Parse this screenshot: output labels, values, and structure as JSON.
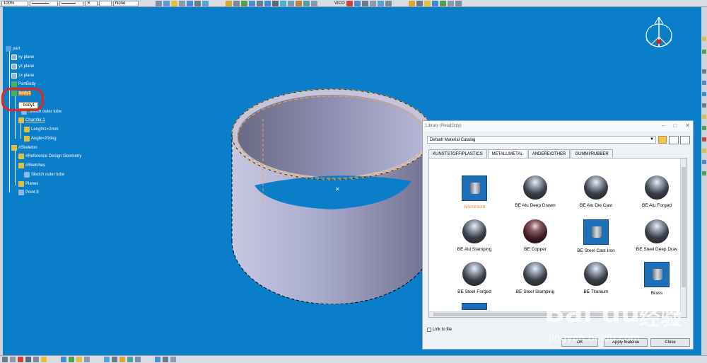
{
  "toolbar": {
    "zoom": "100%",
    "line_type": "",
    "line_weight": "",
    "pattern": "",
    "layer": "None",
    "vico": "VICO"
  },
  "tree": {
    "root": "part",
    "items": [
      {
        "label": "xy plane"
      },
      {
        "label": "yz plane"
      },
      {
        "label": "zx plane"
      },
      {
        "label": "PartBody"
      },
      {
        "label": "body1"
      },
      {
        "label": "Sketch outer tube"
      },
      {
        "label": "Chamfer.1"
      },
      {
        "label": "Length1=2mm"
      },
      {
        "label": "Angle=20deg"
      },
      {
        "label": "#Skeleton"
      },
      {
        "label": "#Reference Design Geometry"
      },
      {
        "label": "#Sketches"
      },
      {
        "label": "Sketch outer tube"
      },
      {
        "label": "Planes"
      },
      {
        "label": "Point.9"
      }
    ],
    "tooltip": "body1"
  },
  "dialog": {
    "title": "Library (ReadOnly)",
    "catalog": "Default Material Catalog",
    "tabs": [
      "KUNSTSTOFF/PLASTICS",
      "METALL/METAL",
      "ANDERE/OTHER",
      "GUMMI/RUBBER"
    ],
    "materials": [
      {
        "label": "Aluminium",
        "kind": "swatch"
      },
      {
        "label": "BE Alu Deep Drawn",
        "kind": "sphere"
      },
      {
        "label": "BE Alu Die Cast",
        "kind": "sphere"
      },
      {
        "label": "BE Alu Forged",
        "kind": "sphere"
      },
      {
        "label": "BE Alu Stamping",
        "kind": "sphere"
      },
      {
        "label": "BE Copper",
        "kind": "copper"
      },
      {
        "label": "BE Steel Cast Iron",
        "kind": "swatch"
      },
      {
        "label": "BE Steel Deep Drav",
        "kind": "sphere"
      },
      {
        "label": "BE Steel Forged",
        "kind": "sphere"
      },
      {
        "label": "BE Steel Stamping",
        "kind": "sphere"
      },
      {
        "label": "BE Titanium",
        "kind": "sphere"
      },
      {
        "label": "Brass",
        "kind": "swatch"
      }
    ],
    "link_to_file": "Link to file",
    "ok": "OK",
    "apply": "Apply Material",
    "close": "Close"
  },
  "watermark": {
    "brand": "Bai du",
    "brand_cn": "经验",
    "url": "jingyan.baidu.com"
  },
  "colors": {
    "viewport": "#0a7ec9",
    "selection": "#f08a1a",
    "highlight": "#e8241c"
  }
}
